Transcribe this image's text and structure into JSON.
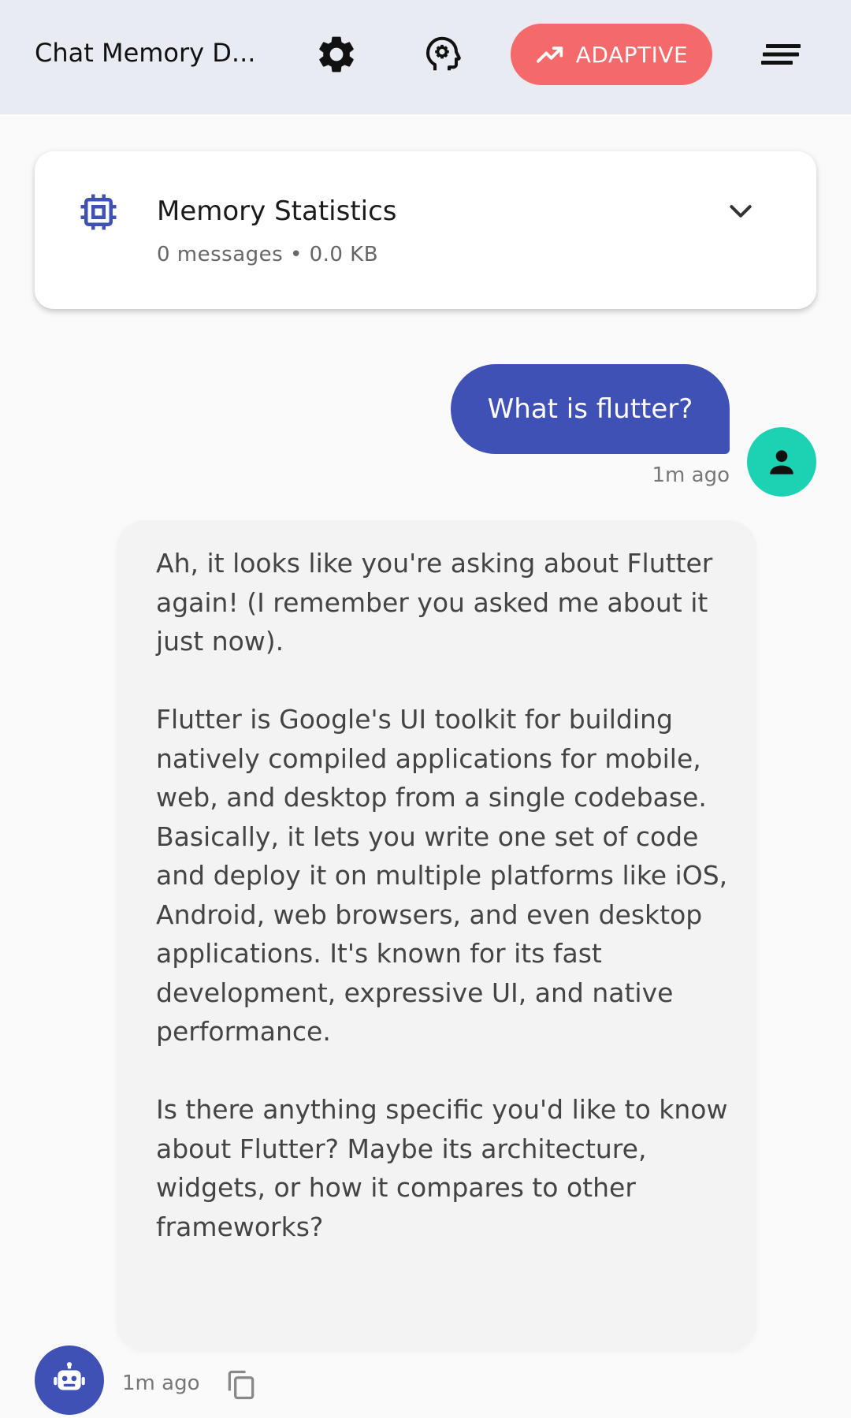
{
  "appbar": {
    "title": "Chat Memory D...",
    "settings_icon": "gear-icon",
    "brain_icon": "psychology-icon",
    "mode_button": {
      "icon": "trending-up-icon",
      "label": "ADAPTIVE"
    },
    "menu_icon": "sort-menu-icon"
  },
  "colors": {
    "appbar_bg": "#e9ebf2",
    "accent": "#3f51b5",
    "adaptive": "#f46a6a",
    "user_avatar": "#1dd1b3"
  },
  "stats": {
    "icon": "memory-chip-icon",
    "title": "Memory Statistics",
    "subtitle": "0 messages • 0.0 KB",
    "toggle_icon": "chevron-down-icon"
  },
  "messages": [
    {
      "role": "user",
      "text": "What is flutter?",
      "time": "1m ago",
      "avatar_icon": "person-icon"
    },
    {
      "role": "assistant",
      "text": "Ah, it looks like you're asking about Flutter again! (I remember you asked me about it just now).\n\nFlutter is Google's UI toolkit for building natively compiled applications for mobile, web, and desktop from a single codebase. Basically, it lets you write one set of code and deploy it on multiple platforms like iOS, Android, web browsers, and even desktop applications. It's known for its fast development, expressive UI, and native performance.\n\nIs there anything specific you'd like to know about Flutter? Maybe its architecture, widgets, or how it compares to other frameworks?",
      "time": "1m ago",
      "avatar_icon": "robot-icon",
      "action_icon": "copy-icon"
    }
  ]
}
